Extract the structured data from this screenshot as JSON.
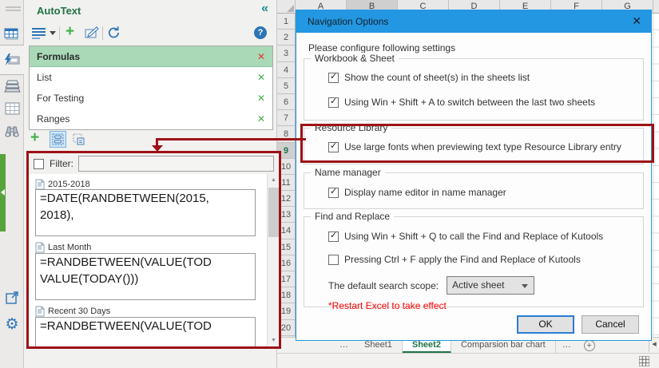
{
  "icons": {
    "collapse": "«",
    "help": "?",
    "add": "+",
    "check": "✓",
    "remove": "✕",
    "scroll_up": "▲",
    "scroll_down": "▼",
    "tab_scroll_left": "◀",
    "gear": "⚙",
    "close": "✕",
    "ellipsis": "…",
    "new_sheet": "+"
  },
  "panel": {
    "title": "AutoText",
    "categories": [
      {
        "name": "Formulas",
        "selected": true
      },
      {
        "name": "List",
        "selected": false
      },
      {
        "name": "For Testing",
        "selected": false
      },
      {
        "name": "Ranges",
        "selected": false
      }
    ],
    "filter_label": "Filter:",
    "filter_value": "",
    "entries": [
      {
        "name": "2015-2018",
        "formula": "=DATE(RANDBETWEEN(2015,\n2018),"
      },
      {
        "name": "Last Month",
        "formula": "=RANDBETWEEN(VALUE(TOD\nVALUE(TODAY()))"
      },
      {
        "name": "Recent 30 Days",
        "formula": "=RANDBETWEEN(VALUE(TOD"
      }
    ]
  },
  "dialog": {
    "title": "Navigation Options",
    "intro": "Please configure following settings",
    "groups": [
      {
        "legend": "Workbook & Sheet",
        "highlighted": false,
        "items": [
          {
            "label": "Show the count of sheet(s) in the sheets list",
            "checked": true,
            "mark": "✓"
          },
          {
            "label": "Using Win + Shift + A to switch between the last two sheets",
            "checked": true,
            "mark": "✓"
          }
        ]
      },
      {
        "legend": "Resource Library",
        "highlighted": true,
        "items": [
          {
            "label": "Use large fonts when previewing text type Resource Library entry",
            "checked": true,
            "mark": "✓"
          }
        ]
      },
      {
        "legend": "Name manager",
        "highlighted": false,
        "items": [
          {
            "label": "Display name editor in name manager",
            "checked": true,
            "mark": "✓"
          }
        ]
      },
      {
        "legend": "Find and Replace",
        "highlighted": false,
        "items": [
          {
            "label": "Using Win + Shift + Q to call the Find and Replace of Kutools",
            "checked": true,
            "mark": "✓"
          },
          {
            "label": "Pressing Ctrl + F apply the Find and Replace of Kutools",
            "checked": false,
            "mark": ""
          }
        ]
      }
    ],
    "scope_label": "The default search scope:",
    "scope_value": "Active sheet",
    "note": "*Restart Excel to take effect",
    "ok_label": "OK",
    "cancel_label": "Cancel"
  },
  "excel": {
    "columns": [
      "A",
      "B",
      "C",
      "D",
      "E",
      "F",
      "G"
    ],
    "active_column": "B",
    "rows": [
      "1",
      "2",
      "3",
      "4",
      "5",
      "6",
      "7",
      "8",
      "9",
      "10",
      "11",
      "12",
      "13",
      "14",
      "15",
      "16",
      "17",
      "18",
      "19",
      "20"
    ],
    "active_row": "9",
    "sheet_tabs": [
      {
        "label": "Sheet1",
        "active": false
      },
      {
        "label": "Sheet2",
        "active": true
      },
      {
        "label": "Comparsion bar chart",
        "active": false
      }
    ]
  },
  "colors": {
    "accent_blue": "#2397e2",
    "excel_green": "#217346",
    "highlight_red": "#9d1216",
    "warning_red": "#ff0000",
    "selection_green_bg": "#a9d9b7"
  }
}
